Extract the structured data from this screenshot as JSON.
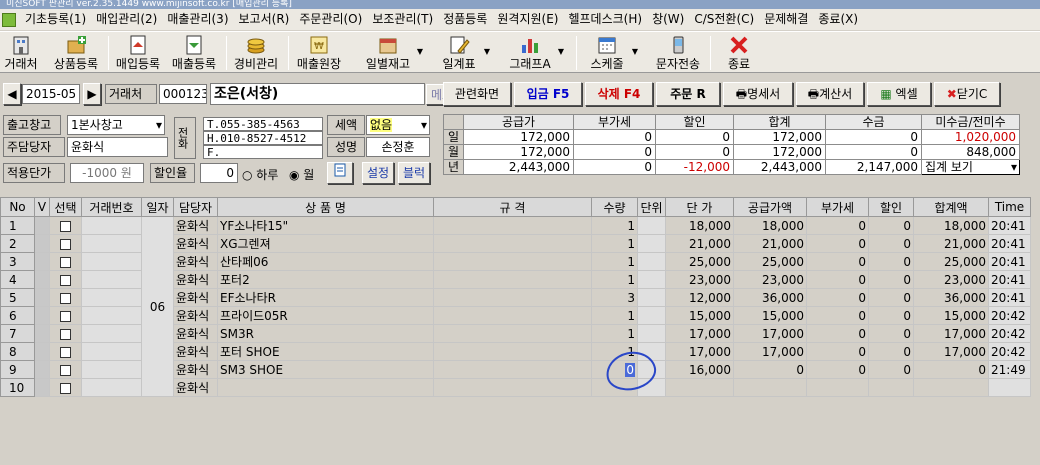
{
  "titlebar": {
    "text": "미진SOFT 판관리 ver.2.35.1449          www.mijinsoft.co.kr       [매입관리 등록]"
  },
  "menu": [
    "기초등록(1)",
    "매입관리(2)",
    "매출관리(3)",
    "보고서(R)",
    "주문관리(O)",
    "보조관리(T)",
    "정품등록",
    "원격지원(E)",
    "헬프데스크(H)",
    "창(W)",
    "C/S전환(C)",
    "문제해결",
    "종료(X)"
  ],
  "toolbar": [
    "거래처",
    "상품등록",
    "매입등록",
    "매출등록",
    "경비관리",
    "매출원장",
    "일별재고",
    "일계표",
    "그래프A",
    "스케줄",
    "문자전송",
    "종료"
  ],
  "form": {
    "month": "2015-05",
    "partner_label": "거래처",
    "partner_code": "000123",
    "partner_name": "조은(서창)",
    "memo": "메모",
    "warehouse_label": "출고창고",
    "warehouse": "1본사창고",
    "manager_label": "주담당자",
    "manager": "윤화식",
    "price_label": "적용단가",
    "price_value": "-1000 원",
    "discount_label": "할인율",
    "discount_value": "0",
    "radio_day": "하루",
    "radio_month": "월",
    "phone_label": "전화",
    "tel": "T.055-385-4563",
    "hp": "H.010-8527-4512",
    "fax": "F.",
    "tax_label": "세액",
    "tax_value": "없음",
    "name_label": "성명",
    "name_value": "손정훈",
    "settings": "설정",
    "block": "블럭"
  },
  "actions": {
    "related": "관련화면",
    "deposit": "입금 F5",
    "delete": "삭제 F4",
    "order": "주문 R",
    "statement": "명세서",
    "invoice": "계산서",
    "excel": "엑셀",
    "close": "닫기C"
  },
  "summary": {
    "headers": [
      "공급가",
      "부가세",
      "할인",
      "합계",
      "수금",
      "미수금/전미수"
    ],
    "rows": [
      {
        "key": "일",
        "vals": [
          "172,000",
          "0",
          "0",
          "172,000",
          "0",
          "1,020,000"
        ]
      },
      {
        "key": "월",
        "vals": [
          "172,000",
          "0",
          "0",
          "172,000",
          "0",
          "848,000"
        ]
      },
      {
        "key": "년",
        "vals": [
          "2,443,000",
          "0",
          "-12,000",
          "2,443,000",
          "2,147,000",
          "집계 보기"
        ]
      }
    ]
  },
  "grid": {
    "headers": [
      "No",
      "V",
      "선택",
      "거래번호",
      "일자",
      "담당자",
      "상 품 명",
      "규 격",
      "수량",
      "단위",
      "단 가",
      "공급가액",
      "부가세",
      "할인",
      "합계액",
      "Time"
    ],
    "day": "06",
    "rows": [
      {
        "no": "1",
        "mgr": "윤화식",
        "item": "YF소나타15\"",
        "qty": "1",
        "price": "18,000",
        "supply": "18,000",
        "vat": "0",
        "disc": "0",
        "total": "18,000",
        "time": "20:41"
      },
      {
        "no": "2",
        "mgr": "윤화식",
        "item": "XG그렌져",
        "qty": "1",
        "price": "21,000",
        "supply": "21,000",
        "vat": "0",
        "disc": "0",
        "total": "21,000",
        "time": "20:41"
      },
      {
        "no": "3",
        "mgr": "윤화식",
        "item": "산타페06",
        "qty": "1",
        "price": "25,000",
        "supply": "25,000",
        "vat": "0",
        "disc": "0",
        "total": "25,000",
        "time": "20:41"
      },
      {
        "no": "4",
        "mgr": "윤화식",
        "item": "포터2",
        "qty": "1",
        "price": "23,000",
        "supply": "23,000",
        "vat": "0",
        "disc": "0",
        "total": "23,000",
        "time": "20:41"
      },
      {
        "no": "5",
        "mgr": "윤화식",
        "item": "EF소나타R",
        "qty": "3",
        "price": "12,000",
        "supply": "36,000",
        "vat": "0",
        "disc": "0",
        "total": "36,000",
        "time": "20:41"
      },
      {
        "no": "6",
        "mgr": "윤화식",
        "item": "프라이드05R",
        "qty": "1",
        "price": "15,000",
        "supply": "15,000",
        "vat": "0",
        "disc": "0",
        "total": "15,000",
        "time": "20:42"
      },
      {
        "no": "7",
        "mgr": "윤화식",
        "item": "SM3R",
        "qty": "1",
        "price": "17,000",
        "supply": "17,000",
        "vat": "0",
        "disc": "0",
        "total": "17,000",
        "time": "20:42"
      },
      {
        "no": "8",
        "mgr": "윤화식",
        "item": "포터 SHOE",
        "qty": "1",
        "price": "17,000",
        "supply": "17,000",
        "vat": "0",
        "disc": "0",
        "total": "17,000",
        "time": "20:42"
      },
      {
        "no": "9",
        "mgr": "윤화식",
        "item": "SM3 SHOE",
        "qty": "0",
        "price": "16,000",
        "supply": "0",
        "vat": "0",
        "disc": "0",
        "total": "0",
        "time": "21:49"
      },
      {
        "no": "10",
        "mgr": "윤화식",
        "item": "",
        "qty": "",
        "price": "",
        "supply": "",
        "vat": "",
        "disc": "",
        "total": "",
        "time": ""
      }
    ]
  },
  "colors": {
    "accent_red": "#cc0000",
    "deposit_blue": "#0000cc",
    "annotation": "#2a47c8"
  }
}
